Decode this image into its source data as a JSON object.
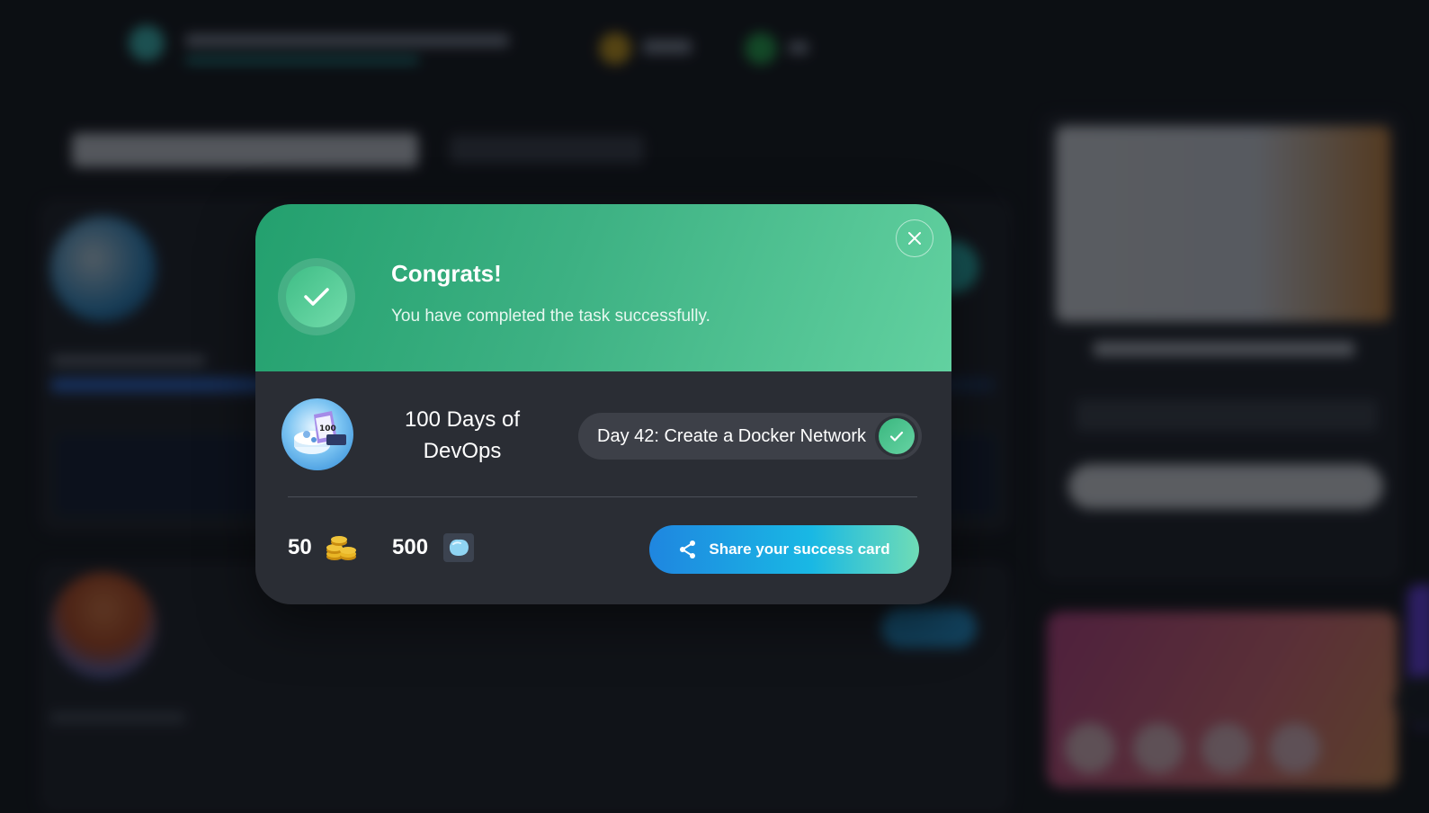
{
  "modal": {
    "title": "Congrats!",
    "subtitle": "You have completed the task successfully.",
    "course_name": "100 Days of DevOps",
    "task_label": "Day 42: Create a Docker Network",
    "rewards": {
      "coins": "50",
      "gems": "500"
    },
    "share_label": "Share your success card"
  },
  "colors": {
    "header_start": "#23a06e",
    "header_end": "#62d1a0",
    "modal_bg": "#2a2d34",
    "share_start": "#1f86e0",
    "share_end": "#6fdcb6"
  },
  "icons": {
    "close": "close-icon",
    "success": "checkmark-icon",
    "task_done": "checkmark-icon",
    "coins": "coins-icon",
    "gem": "gem-icon",
    "share": "share-icon"
  }
}
